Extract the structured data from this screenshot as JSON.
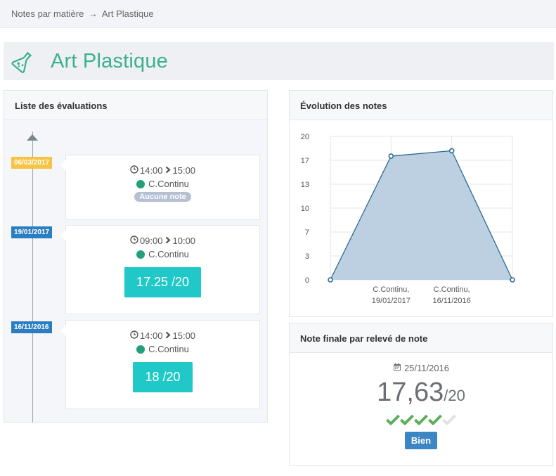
{
  "breadcrumb": {
    "parent": "Notes par matière",
    "separator": "→",
    "current": "Art Plastique"
  },
  "page": {
    "title": "Art Plastique",
    "icon": "flask-icon",
    "accent_color": "#3bb08f"
  },
  "evaluations_panel": {
    "title": "Liste des évaluations",
    "items": [
      {
        "date": "06/03/2017",
        "badge_color": "#f6c344",
        "start": "14:00",
        "end": "15:00",
        "type": "C.Continu",
        "note": null,
        "no_note_label": "Aucune note"
      },
      {
        "date": "19/01/2017",
        "badge_color": "#2a7ec1",
        "start": "09:00",
        "end": "10:00",
        "type": "C.Continu",
        "note": "17.25 /20"
      },
      {
        "date": "16/11/2016",
        "badge_color": "#2a7ec1",
        "start": "14:00",
        "end": "15:00",
        "type": "C.Continu",
        "note": "18 /20"
      }
    ]
  },
  "chart_panel": {
    "title": "Évolution des notes"
  },
  "chart_data": {
    "type": "area",
    "y_ticks": [
      "0",
      "3",
      "7",
      "10",
      "13",
      "17",
      "20"
    ],
    "ylim": [
      0,
      20
    ],
    "x": [
      {
        "label_line1": "",
        "label_line2": ""
      },
      {
        "label_line1": "C.Continu,",
        "label_line2": "19/01/2017"
      },
      {
        "label_line1": "C.Continu,",
        "label_line2": "16/11/2016"
      },
      {
        "label_line1": "",
        "label_line2": ""
      }
    ],
    "values": [
      0,
      17.25,
      18,
      0
    ],
    "fill_color": "#b8cde0",
    "line_color": "#2b6a92",
    "grid": true
  },
  "final_panel": {
    "title": "Note finale par relevé de note",
    "date": "25/11/2016",
    "grade_main": "17,63",
    "grade_suffix": "/20",
    "checks_filled": 4,
    "checks_total": 5,
    "check_color": "#5cae5c",
    "check_empty_color": "#e2e2e2",
    "mention": "Bien",
    "mention_color": "#3d86c6"
  }
}
